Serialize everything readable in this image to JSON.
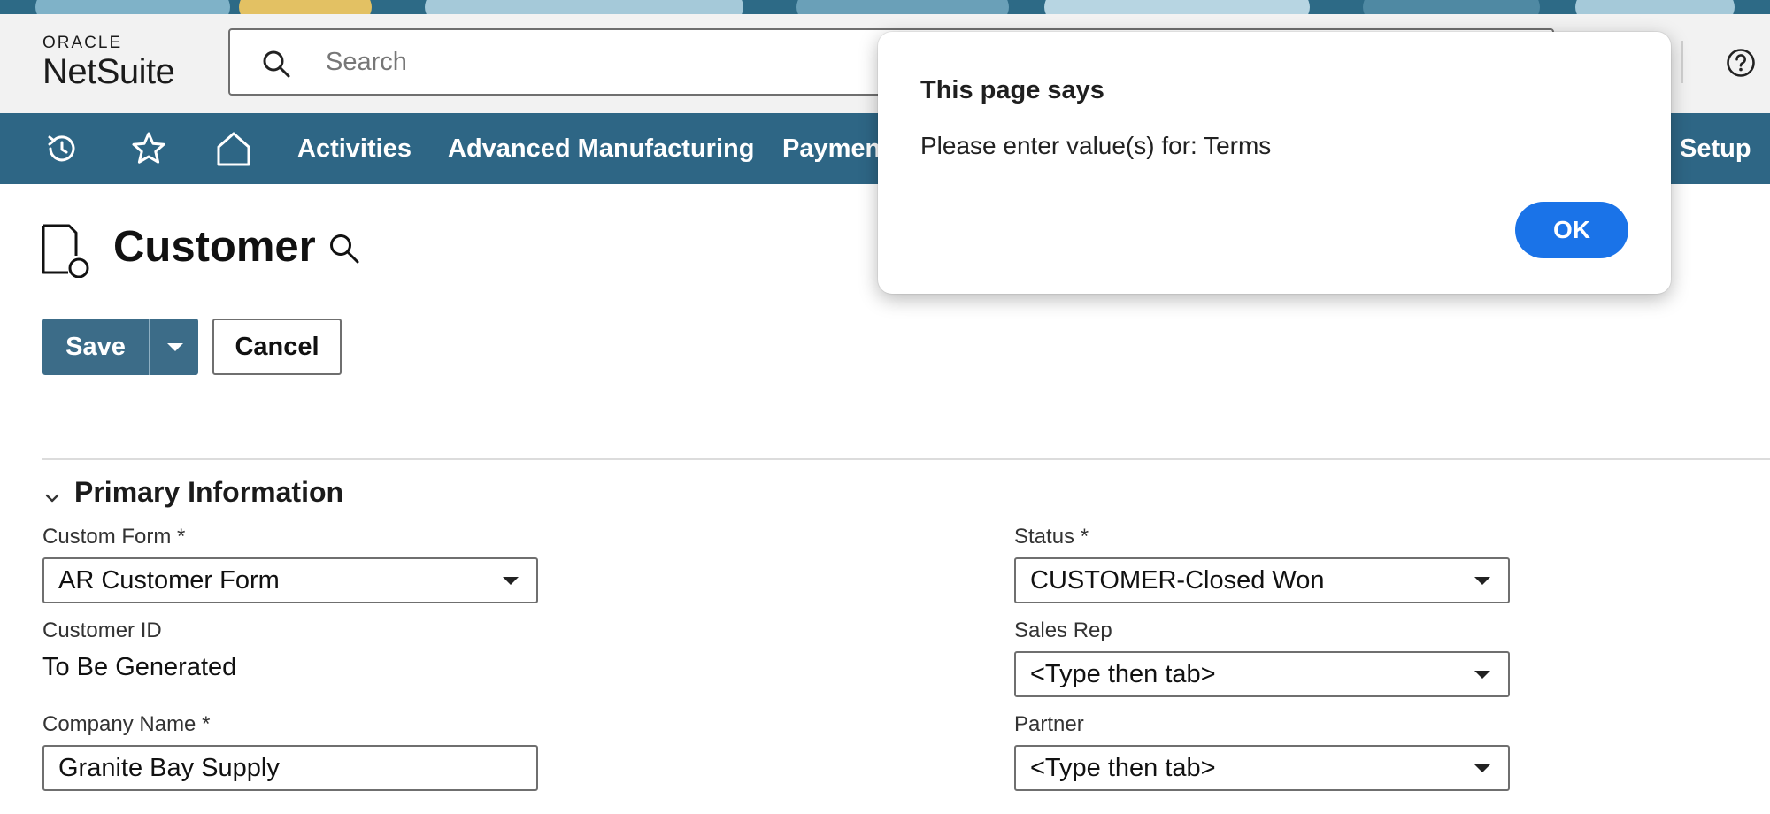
{
  "brand": {
    "oracle": "ORACLE",
    "netsuite": "NetSuite"
  },
  "search": {
    "placeholder": "Search"
  },
  "nav": {
    "items": [
      "Activities",
      "Advanced Manufacturing",
      "Payments",
      "Setup"
    ],
    "icons": [
      "recent-records-icon",
      "star-icon",
      "home-icon"
    ]
  },
  "page": {
    "title": "Customer"
  },
  "actions": {
    "save": "Save",
    "cancel": "Cancel"
  },
  "section": {
    "title": "Primary Information"
  },
  "fields": {
    "custom_form": {
      "label": "Custom Form *",
      "value": "AR Customer Form"
    },
    "customer_id": {
      "label": "Customer ID",
      "value": "To Be Generated"
    },
    "company_name": {
      "label": "Company Name *",
      "value": "Granite Bay Supply"
    },
    "status": {
      "label": "Status *",
      "value": "CUSTOMER-Closed Won"
    },
    "sales_rep": {
      "label": "Sales Rep",
      "value": "<Type then tab>"
    },
    "partner": {
      "label": "Partner",
      "value": "<Type then tab>"
    }
  },
  "dialog": {
    "title": "This page says",
    "message": "Please enter value(s) for: Terms",
    "ok": "OK"
  },
  "colors": {
    "nav": "#2e6685",
    "save": "#3c6c88",
    "ok": "#1a73e8"
  }
}
